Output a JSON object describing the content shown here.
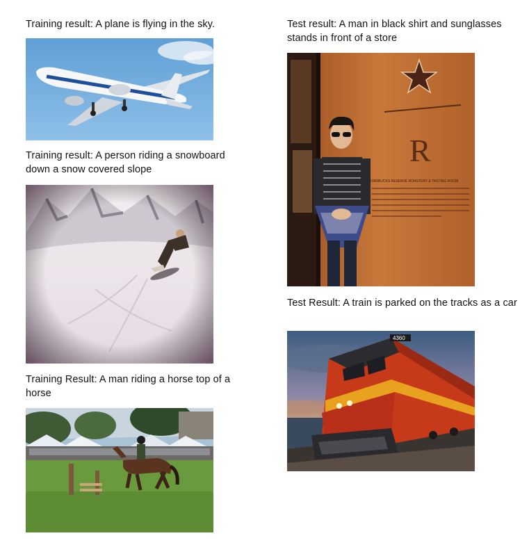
{
  "captions": {
    "plane": "Training result: A plane is flying in the sky.",
    "snowboard": "Training result: A person riding a snowboard down a snow covered slope",
    "horse": "Training Result: A man riding a horse top of a horse",
    "man": "Test result: A man in black shirt and sunglasses stands in front of a store",
    "train": "Test Result: A train is parked on the tracks as a car"
  },
  "image_text": {
    "store_sign_letter": "R",
    "store_sign_line": "STARBUCKS RESERVE ROASTERY & TASTING ROOM",
    "train_number": "4360"
  }
}
